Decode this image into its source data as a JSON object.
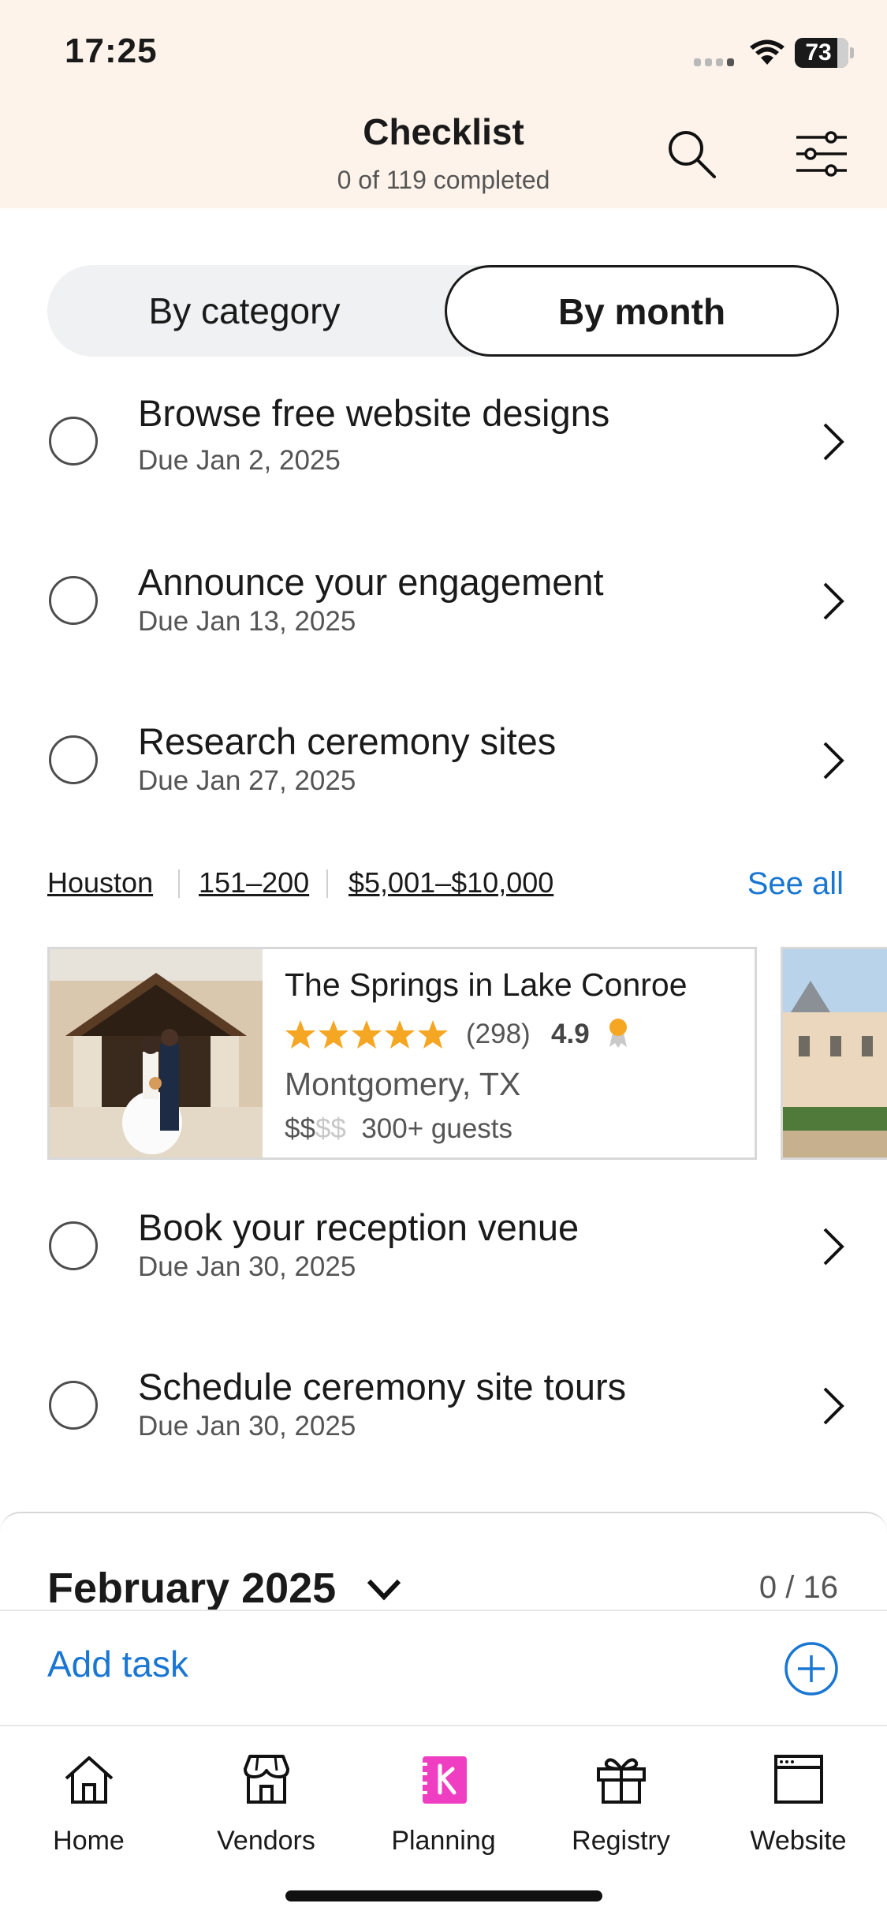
{
  "status_bar": {
    "time": "17:25",
    "battery": "73"
  },
  "header": {
    "title": "Checklist",
    "subtitle": "0 of 119 completed"
  },
  "segment": {
    "left_label": "By category",
    "right_label": "By month",
    "selected": "By month"
  },
  "tasks_before": [
    {
      "title": "Browse free website designs",
      "due": "Due Jan 2, 2025"
    },
    {
      "title": "Announce your engagement",
      "due": "Due Jan 13, 2025"
    },
    {
      "title": "Research ceremony sites",
      "due": "Due Jan 27, 2025"
    }
  ],
  "vendor_filters": {
    "location": "Houston",
    "guests": "151–200",
    "budget": "$5,001–$10,000",
    "see_all": "See all"
  },
  "vendor_card": {
    "name": "The Springs in Lake Conroe",
    "reviews": "(298)",
    "rating": "4.9",
    "stars": 5,
    "location": "Montgomery, TX",
    "price_active": "$$",
    "price_dim": "$$",
    "guests": "300+ guests"
  },
  "tasks_after": [
    {
      "title": "Book your reception venue",
      "due": "Due Jan 30, 2025"
    },
    {
      "title": "Schedule ceremony site tours",
      "due": "Due Jan 30, 2025"
    }
  ],
  "month_section": {
    "title": "February 2025",
    "count": "0 / 16"
  },
  "add_task": {
    "label": "Add task"
  },
  "tabbar": {
    "items": [
      {
        "label": "Home",
        "icon": "home-icon"
      },
      {
        "label": "Vendors",
        "icon": "storefront-icon"
      },
      {
        "label": "Planning",
        "icon": "planning-icon",
        "active": true
      },
      {
        "label": "Registry",
        "icon": "gift-icon"
      },
      {
        "label": "Website",
        "icon": "browser-window-icon"
      }
    ]
  },
  "colors": {
    "header_bg": "#fdf3ea",
    "accent_blue": "#1976d2",
    "star": "#f5a623",
    "planning_pink": "#f03ec3"
  }
}
